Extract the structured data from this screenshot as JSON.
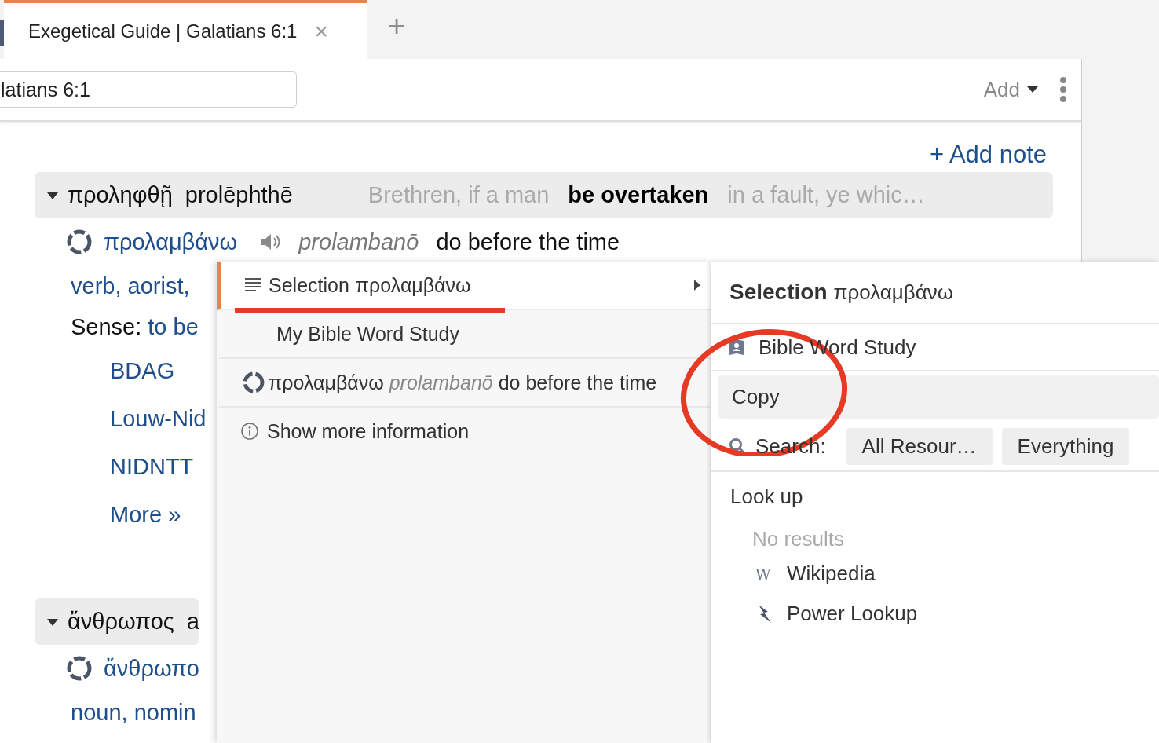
{
  "tabs": [
    {
      "label": "Exegetical Guide | Galatians 6:1",
      "selected": true,
      "close": "×"
    }
  ],
  "new_tab": "+",
  "toolbar": {
    "reference": "latians 6:1",
    "add_menu": "Add"
  },
  "add_note": "+ Add note",
  "entries": [
    {
      "expanded": true,
      "greek": "προληφθῇ",
      "translit": "prolēphthē",
      "context_before": "Brethren, if a man",
      "context_word": "be overtaken",
      "context_after": "in a fault, ye whic…",
      "lemma": "προλαμβάνω",
      "lemma_translit": "prolambanō",
      "gloss": "do before the time",
      "parsing": "verb, aorist,",
      "sense_label": "Sense:",
      "sense": "to be",
      "lexicons": [
        "BDAG",
        "Louw-Nid",
        "NIDNTT"
      ],
      "more": "More »"
    },
    {
      "expanded": true,
      "greek": "ἄνθρωπος",
      "translit": "a",
      "lemma": "ἄνθρωπο",
      "parsing": "noun, nomin"
    }
  ],
  "context_menu": {
    "items": [
      {
        "kind": "selection",
        "label": "Selection",
        "term": "προλαμβάνω",
        "selected": true
      },
      {
        "kind": "plain",
        "label": "My Bible Word Study",
        "selected": false
      },
      {
        "kind": "lemma",
        "lemma": "προλαμβάνω",
        "translit": "prolambanō",
        "gloss": "do before the time",
        "selected": false
      },
      {
        "kind": "info",
        "label": "Show more information",
        "selected": false
      }
    ]
  },
  "submenu": {
    "title": "Selection",
    "term": "προλαμβάνω",
    "items": [
      {
        "kind": "guide",
        "label": "Bible Word Study",
        "selected": false
      },
      {
        "kind": "plain",
        "label": "Copy",
        "selected": true
      },
      {
        "kind": "search",
        "label": "Search:",
        "options": [
          "All Resour…",
          "Everything"
        ],
        "selected": false
      }
    ],
    "lookup": {
      "title": "Look up",
      "empty": "No results",
      "links": [
        {
          "kind": "wikipedia",
          "label": "Wikipedia",
          "icon": "W"
        },
        {
          "kind": "power",
          "label": "Power Lookup"
        }
      ]
    }
  }
}
